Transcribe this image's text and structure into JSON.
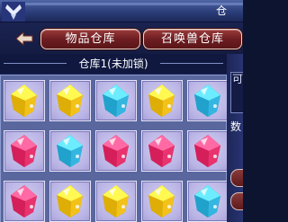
{
  "header": {
    "strip_label": "仓"
  },
  "tabs": [
    {
      "label": "物品仓库"
    },
    {
      "label": "召唤兽仓库"
    }
  ],
  "warehouse": {
    "caption": "仓库1(未加锁)"
  },
  "side_panel": {
    "box_text": "可",
    "label": "数"
  },
  "gem_colors": {
    "gold": "#f2c21b",
    "red": "#e8336e",
    "blue": "#35b6e0"
  },
  "grid": [
    [
      "gold",
      "gold",
      "blue",
      "gold",
      "blue"
    ],
    [
      "red",
      "blue",
      "red",
      "red",
      "red"
    ],
    [
      "red",
      "gold",
      "gold",
      "gold",
      "blue"
    ]
  ]
}
